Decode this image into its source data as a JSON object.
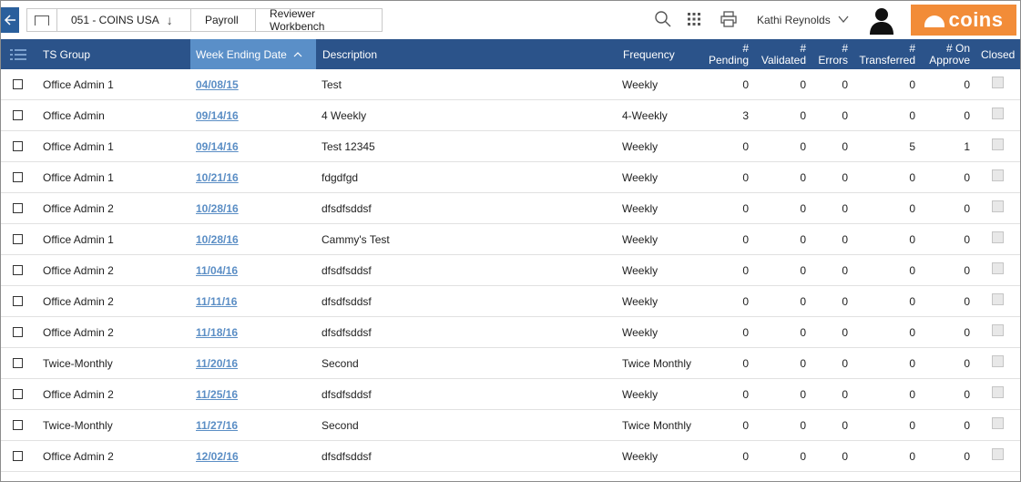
{
  "breadcrumb": {
    "company": "051 - COINS USA",
    "module": "Payroll",
    "page": "Reviewer Workbench"
  },
  "user": {
    "name": "Kathi Reynolds"
  },
  "logo_text": "coins",
  "colors": {
    "header_bg": "#2b538a",
    "sorted_header_bg": "#5a8fc8",
    "brand": "#f28c38",
    "link": "#5b8ec5"
  },
  "icons": [
    "back-arrow-icon",
    "home-icon",
    "chevron-down-icon",
    "search-icon",
    "apps-grid-icon",
    "print-icon",
    "user-avatar-icon",
    "menu-icon",
    "sort-up-icon"
  ],
  "table": {
    "columns": {
      "ts_group": "TS Group",
      "week_ending": "Week Ending Date",
      "description": "Description",
      "frequency": "Frequency",
      "pending_1": "#",
      "pending_2": "Pending",
      "validated_1": "#",
      "validated_2": "Validated",
      "errors_1": "#",
      "errors_2": "Errors",
      "transferred_1": "#",
      "transferred_2": "Transferred",
      "approve_1": "# On",
      "approve_2": "Approve",
      "closed": "Closed"
    },
    "rows": [
      {
        "group": "Office Admin 1",
        "date": "04/08/15",
        "desc": "Test",
        "freq": "Weekly",
        "pending": "0",
        "validated": "0",
        "errors": "0",
        "transferred": "0",
        "approve": "0"
      },
      {
        "group": "Office Admin",
        "date": "09/14/16",
        "desc": "4 Weekly",
        "freq": "4-Weekly",
        "pending": "3",
        "validated": "0",
        "errors": "0",
        "transferred": "0",
        "approve": "0"
      },
      {
        "group": "Office Admin 1",
        "date": "09/14/16",
        "desc": "Test 12345",
        "freq": "Weekly",
        "pending": "0",
        "validated": "0",
        "errors": "0",
        "transferred": "5",
        "approve": "1"
      },
      {
        "group": "Office Admin 1",
        "date": "10/21/16",
        "desc": "fdgdfgd",
        "freq": "Weekly",
        "pending": "0",
        "validated": "0",
        "errors": "0",
        "transferred": "0",
        "approve": "0"
      },
      {
        "group": "Office Admin 2",
        "date": "10/28/16",
        "desc": "dfsdfsddsf",
        "freq": "Weekly",
        "pending": "0",
        "validated": "0",
        "errors": "0",
        "transferred": "0",
        "approve": "0"
      },
      {
        "group": "Office Admin 1",
        "date": "10/28/16",
        "desc": "Cammy's Test",
        "freq": "Weekly",
        "pending": "0",
        "validated": "0",
        "errors": "0",
        "transferred": "0",
        "approve": "0"
      },
      {
        "group": "Office Admin 2",
        "date": "11/04/16",
        "desc": "dfsdfsddsf",
        "freq": "Weekly",
        "pending": "0",
        "validated": "0",
        "errors": "0",
        "transferred": "0",
        "approve": "0"
      },
      {
        "group": "Office Admin 2",
        "date": "11/11/16",
        "desc": "dfsdfsddsf",
        "freq": "Weekly",
        "pending": "0",
        "validated": "0",
        "errors": "0",
        "transferred": "0",
        "approve": "0"
      },
      {
        "group": "Office Admin 2",
        "date": "11/18/16",
        "desc": "dfsdfsddsf",
        "freq": "Weekly",
        "pending": "0",
        "validated": "0",
        "errors": "0",
        "transferred": "0",
        "approve": "0"
      },
      {
        "group": "Twice-Monthly",
        "date": "11/20/16",
        "desc": "Second",
        "freq": "Twice Monthly",
        "pending": "0",
        "validated": "0",
        "errors": "0",
        "transferred": "0",
        "approve": "0"
      },
      {
        "group": "Office Admin 2",
        "date": "11/25/16",
        "desc": "dfsdfsddsf",
        "freq": "Weekly",
        "pending": "0",
        "validated": "0",
        "errors": "0",
        "transferred": "0",
        "approve": "0"
      },
      {
        "group": "Twice-Monthly",
        "date": "11/27/16",
        "desc": "Second",
        "freq": "Twice Monthly",
        "pending": "0",
        "validated": "0",
        "errors": "0",
        "transferred": "0",
        "approve": "0"
      },
      {
        "group": "Office Admin 2",
        "date": "12/02/16",
        "desc": "dfsdfsddsf",
        "freq": "Weekly",
        "pending": "0",
        "validated": "0",
        "errors": "0",
        "transferred": "0",
        "approve": "0"
      }
    ]
  }
}
